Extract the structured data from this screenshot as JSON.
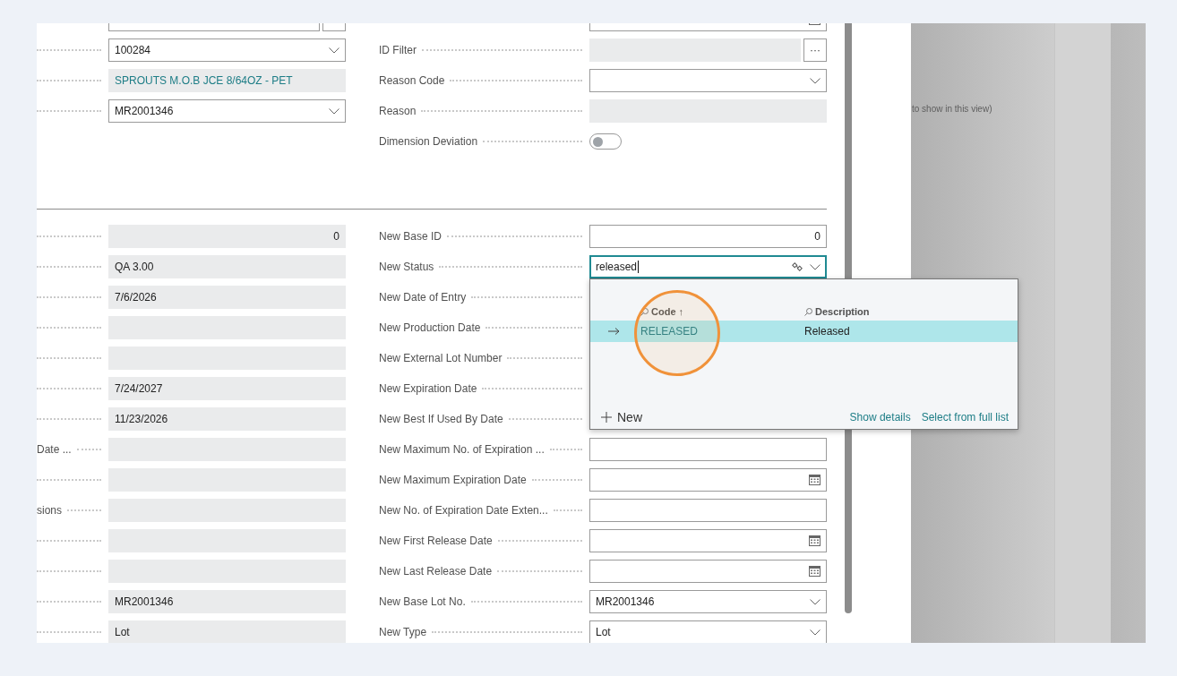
{
  "top_section": {
    "rows": [
      {
        "left": {
          "kind": "button-field"
        },
        "right": {
          "kind": "date"
        }
      },
      {
        "left": {
          "kind": "dropdown",
          "value": "100284"
        },
        "right": {
          "label": "ID Filter",
          "kind": "filter",
          "button": "···"
        }
      },
      {
        "left": {
          "kind": "readonly-link",
          "value": "SPROUTS M.O.B JCE 8/64OZ - PET"
        },
        "right": {
          "label": "Reason Code",
          "kind": "dropdown"
        }
      },
      {
        "left": {
          "kind": "dropdown",
          "value": "MR2001346"
        },
        "right": {
          "label": "Reason",
          "kind": "readonly"
        }
      },
      {
        "right": {
          "label": "Dimension Deviation",
          "kind": "toggle",
          "on": false
        }
      }
    ]
  },
  "bottom_section": {
    "rows": [
      {
        "left": {
          "kind": "readonly-number",
          "value": "0"
        },
        "right": {
          "label": "New Base ID",
          "kind": "number",
          "value": "0"
        }
      },
      {
        "left": {
          "kind": "readonly",
          "value": "QA 3.00"
        },
        "right": {
          "label": "New Status",
          "kind": "lookup",
          "value": "released",
          "focused": true
        }
      },
      {
        "left": {
          "kind": "readonly",
          "value": "7/6/2026"
        },
        "right": {
          "label": "New Date of Entry"
        }
      },
      {
        "left": {
          "kind": "readonly"
        },
        "right": {
          "label": "New Production Date"
        }
      },
      {
        "left": {
          "kind": "readonly"
        },
        "right": {
          "label": "New External Lot Number"
        }
      },
      {
        "left": {
          "kind": "readonly",
          "value": "7/24/2027"
        },
        "right": {
          "label": "New Expiration Date"
        }
      },
      {
        "left": {
          "kind": "readonly",
          "value": "11/23/2026"
        },
        "right": {
          "label": "New Best If Used By Date"
        }
      },
      {
        "left": {
          "label": "Date ...",
          "kind": "readonly"
        },
        "right": {
          "label": "New Maximum No. of Expiration ...",
          "kind": "text"
        }
      },
      {
        "left": {
          "kind": "readonly"
        },
        "right": {
          "label": "New Maximum Expiration Date",
          "kind": "date"
        }
      },
      {
        "left": {
          "label": "sions",
          "kind": "readonly"
        },
        "right": {
          "label": "New No. of Expiration Date Exten...",
          "kind": "text"
        }
      },
      {
        "left": {
          "kind": "readonly"
        },
        "right": {
          "label": "New First Release Date",
          "kind": "date"
        }
      },
      {
        "left": {
          "kind": "readonly"
        },
        "right": {
          "label": "New Last Release Date",
          "kind": "date"
        }
      },
      {
        "left": {
          "kind": "readonly",
          "value": "MR2001346"
        },
        "right": {
          "label": "New Base Lot No.",
          "kind": "dropdown",
          "value": "MR2001346"
        }
      },
      {
        "left": {
          "kind": "readonly",
          "value": "Lot"
        },
        "right": {
          "label": "New Type",
          "kind": "dropdown",
          "value": "Lot"
        }
      }
    ]
  },
  "lookup_popup": {
    "columns": [
      "Code ↑",
      "Description"
    ],
    "rows": [
      {
        "code": "RELEASED",
        "description": "Released",
        "selected": true
      }
    ],
    "new_label": "New",
    "links": [
      "Show details",
      "Select from full list"
    ]
  },
  "annotation_circle": true,
  "background_view": {
    "message": "to show in this view)"
  }
}
